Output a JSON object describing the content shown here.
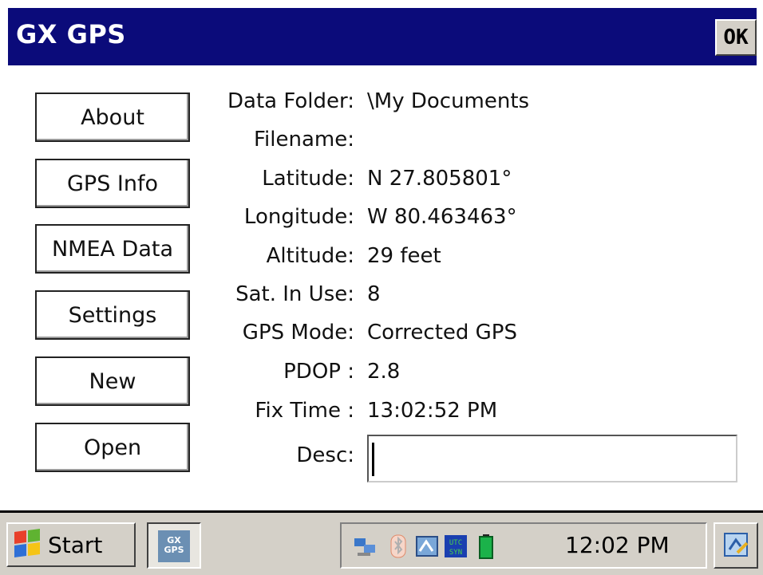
{
  "window": {
    "title": "GX GPS",
    "ok_label": "OK"
  },
  "buttons": [
    "About",
    "GPS Info",
    "NMEA Data",
    "Settings",
    "New",
    "Open"
  ],
  "fields": [
    {
      "label": "Data Folder:",
      "value": "\\My Documents"
    },
    {
      "label": "Filename:",
      "value": ""
    },
    {
      "label": "Latitude:",
      "value": "N 27.805801°"
    },
    {
      "label": "Longitude:",
      "value": "W 80.463463°"
    },
    {
      "label": "Altitude:",
      "value": "29 feet"
    },
    {
      "label": "Sat. In Use:",
      "value": "8"
    },
    {
      "label": "GPS Mode:",
      "value": "Corrected GPS"
    },
    {
      "label": "PDOP :",
      "value": "2.8"
    },
    {
      "label": "Fix Time :",
      "value": "13:02:52 PM"
    }
  ],
  "desc": {
    "label": "Desc:",
    "value": ""
  },
  "taskbar": {
    "start_label": "Start",
    "app_icon_text": "GX GPS",
    "tray_icons": [
      "network-icon",
      "bluetooth-icon",
      "connection-manager-icon",
      "utc-sync-icon",
      "battery-icon"
    ],
    "clock": "12:02 PM"
  },
  "colors": {
    "titlebar": "#0b0b7a",
    "taskbar": "#d4d0c8"
  }
}
